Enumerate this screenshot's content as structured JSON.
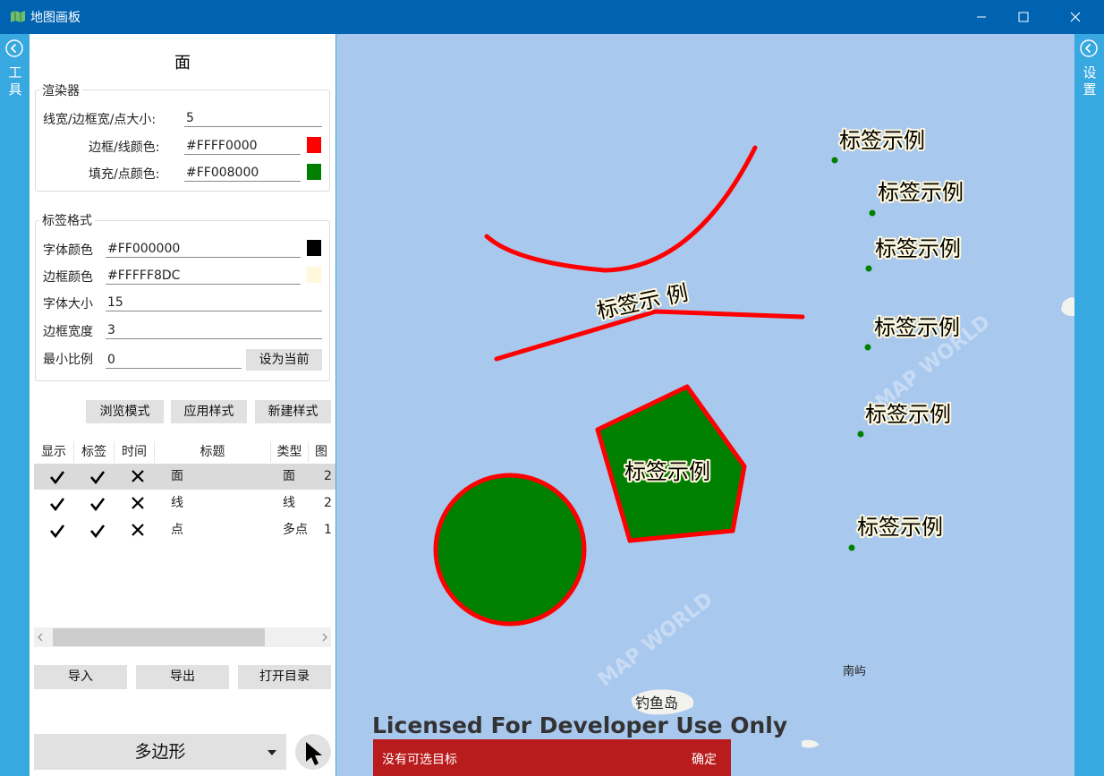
{
  "window": {
    "title": "地图画板"
  },
  "left_strip": {
    "label": "工具"
  },
  "right_strip": {
    "label": "设置"
  },
  "panel": {
    "title": "面",
    "renderer": {
      "legend": "渲染器",
      "line_width_label": "线宽/边框宽/点大小:",
      "line_width_value": "5",
      "border_color_label": "边框/线颜色:",
      "border_color_value": "#FFFF0000",
      "fill_color_label": "填充/点颜色:",
      "fill_color_value": "#FF008000",
      "border_swatch": "#ff0000",
      "fill_swatch": "#008000"
    },
    "label_format": {
      "legend": "标签格式",
      "font_color_label": "字体颜色",
      "font_color_value": "#FF000000",
      "border_color_label": "边框颜色",
      "border_color_value": "#FFFFF8DC",
      "font_size_label": "字体大小",
      "font_size_value": "15",
      "border_width_label": "边框宽度",
      "border_width_value": "3",
      "min_scale_label": "最小比例",
      "min_scale_value": "0",
      "set_current_label": "设为当前",
      "font_swatch": "#000000",
      "border_swatch": "#fff8dc"
    },
    "buttons": {
      "browse": "浏览模式",
      "apply": "应用样式",
      "new_style": "新建样式"
    },
    "table": {
      "headers": [
        "显示",
        "标签",
        "时间",
        "标题",
        "类型",
        "图"
      ],
      "rows": [
        {
          "title": "面",
          "type": "面",
          "count": "2"
        },
        {
          "title": "线",
          "type": "线",
          "count": "2"
        },
        {
          "title": "点",
          "type": "多点",
          "count": "1"
        }
      ]
    },
    "io_buttons": {
      "import": "导入",
      "export": "导出",
      "open_dir": "打开目录"
    },
    "mode_select": {
      "value": "多边形"
    }
  },
  "map": {
    "label_text": "标签示例",
    "line_label": "标签示 例",
    "licensed": "Licensed For Developer Use Only",
    "places": {
      "diaoyu": "钓鱼岛",
      "nanyu": "南屿"
    },
    "watermark": "MAP WORLD",
    "toast": {
      "message": "没有可选目标",
      "ok": "确定"
    },
    "colors": {
      "stroke": "#ff0000",
      "fill": "#008000",
      "halo": "#fff8dc",
      "water": "#a9c8ee"
    }
  }
}
